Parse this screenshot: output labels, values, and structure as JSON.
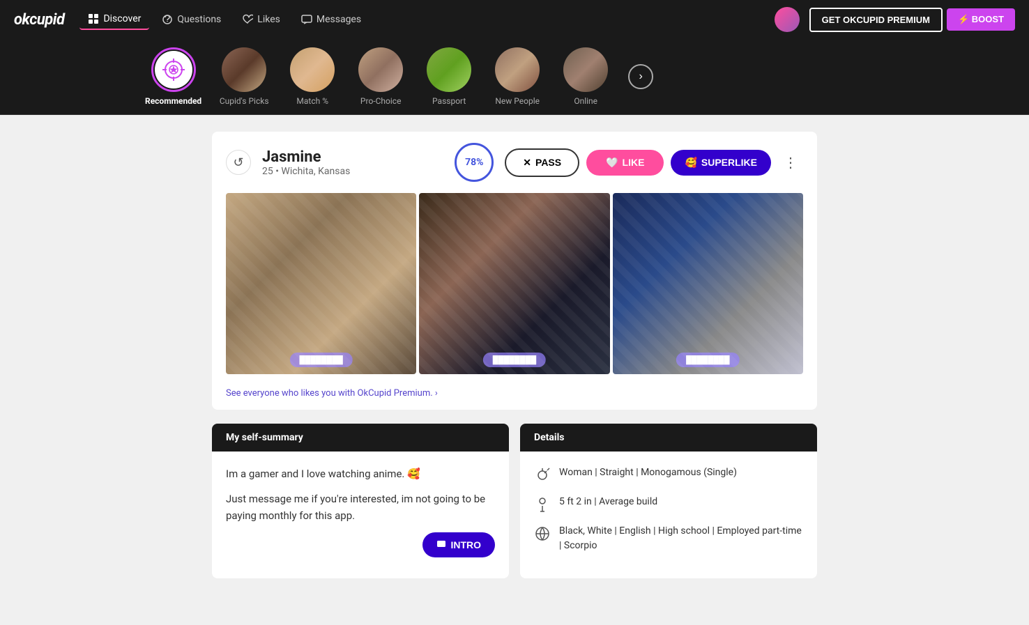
{
  "app": {
    "logo": "okcupid"
  },
  "topnav": {
    "items": [
      {
        "label": "Discover",
        "icon": "grid-icon",
        "active": true
      },
      {
        "label": "Questions",
        "icon": "question-icon",
        "active": false
      },
      {
        "label": "Likes",
        "icon": "heart-icon",
        "active": false
      },
      {
        "label": "Messages",
        "icon": "message-icon",
        "active": false
      }
    ],
    "premium_btn": "GET OKCUPID PREMIUM",
    "boost_btn": "⚡ BOOST"
  },
  "categories": [
    {
      "label": "Recommended",
      "active": true,
      "icon": "recommended"
    },
    {
      "label": "Cupid's Picks",
      "active": false,
      "icon": "photo"
    },
    {
      "label": "Match %",
      "active": false,
      "icon": "photo"
    },
    {
      "label": "Pro-Choice",
      "active": false,
      "icon": "photo"
    },
    {
      "label": "Passport",
      "active": false,
      "icon": "photo"
    },
    {
      "label": "New People",
      "active": false,
      "icon": "photo"
    },
    {
      "label": "Online",
      "active": false,
      "icon": "photo"
    }
  ],
  "profile": {
    "name": "Jasmine",
    "age": "25",
    "location": "Wichita, Kansas",
    "match_pct": "78%",
    "photos": [
      {
        "tag": "blurred"
      },
      {
        "tag": "blurred"
      },
      {
        "tag": "blurred"
      }
    ],
    "likes_promo": "See everyone who likes you with OkCupid Premium. ›",
    "pass_label": "PASS",
    "like_label": "LIKE",
    "superlike_label": "SUPERLIKE",
    "intro_label": "INTRO"
  },
  "bio": {
    "section_title": "My self-summary",
    "text1": "Im a gamer and I love watching anime. 🥰",
    "text2": "Just message me if you're interested, im not going to be paying monthly for this app."
  },
  "details": {
    "section_title": "Details",
    "items": [
      {
        "icon": "gender-icon",
        "text": "Woman | Straight | Monogamous (Single)"
      },
      {
        "icon": "height-icon",
        "text": "5 ft 2 in | Average build"
      },
      {
        "icon": "globe-icon",
        "text": "Black, White | English | High school | Employed part-time | Scorpio"
      }
    ]
  }
}
